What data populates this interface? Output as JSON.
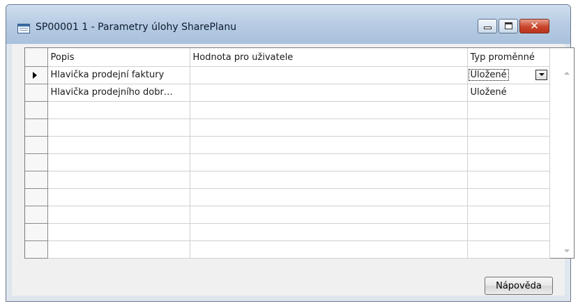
{
  "window": {
    "title": "SP00001 1 - Parametry úlohy SharePlanu"
  },
  "grid": {
    "columns": [
      "Popis",
      "Hodnota pro uživatele",
      "Typ proměnné"
    ],
    "rows": [
      {
        "popis": "Hlavička prodejní faktury",
        "hodnota": "",
        "typ": "Uložené"
      },
      {
        "popis": "Hlavička prodejního dobr…",
        "hodnota": "",
        "typ": "Uložené"
      }
    ]
  },
  "buttons": {
    "help": "Nápověda"
  }
}
